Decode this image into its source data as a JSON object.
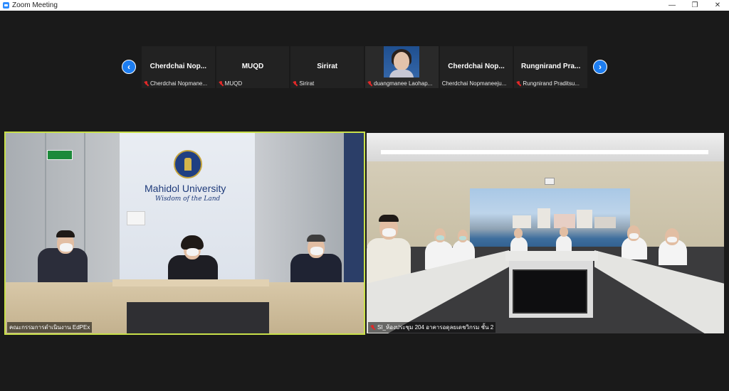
{
  "window": {
    "title": "Zoom Meeting",
    "controls": {
      "minimize": "—",
      "maximize": "❐",
      "close": "✕"
    }
  },
  "gallery": {
    "prev_label": "‹",
    "next_label": "›",
    "thumbs": [
      {
        "display_name": "Cherdchai  Nop...",
        "label": "Cherdchai Nopmane...",
        "muted": true,
        "video": false
      },
      {
        "display_name": "MUQD",
        "label": "MUQD",
        "muted": true,
        "video": false
      },
      {
        "display_name": "Sirirat",
        "label": "Sirirat",
        "muted": true,
        "video": false
      },
      {
        "display_name": "",
        "label": "duangmanee Laohap...",
        "muted": true,
        "video": true
      },
      {
        "display_name": "Cherdchai  Nop...",
        "label": "Cherdchai Nopmaneeju...",
        "muted": false,
        "video": false
      },
      {
        "display_name": "Rungnirand  Pra...",
        "label": "Rungnirand Praditsu...",
        "muted": true,
        "video": false
      }
    ]
  },
  "tiles": {
    "left": {
      "name": "คณะกรรมการดำเนินงาน EdPEx",
      "wall_title": "Mahidol University",
      "wall_motto": "Wisdom of the Land",
      "active_speaker": true
    },
    "right": {
      "name": "SI_ห้องประชุม 204 อาคารอดุลยเดชวิกรม ชั้น 2",
      "active_speaker": false
    }
  },
  "colors": {
    "accent": "#1d7df0",
    "active_border": "#c9e04a",
    "muted": "#e02828",
    "background": "#1a1a1a"
  }
}
